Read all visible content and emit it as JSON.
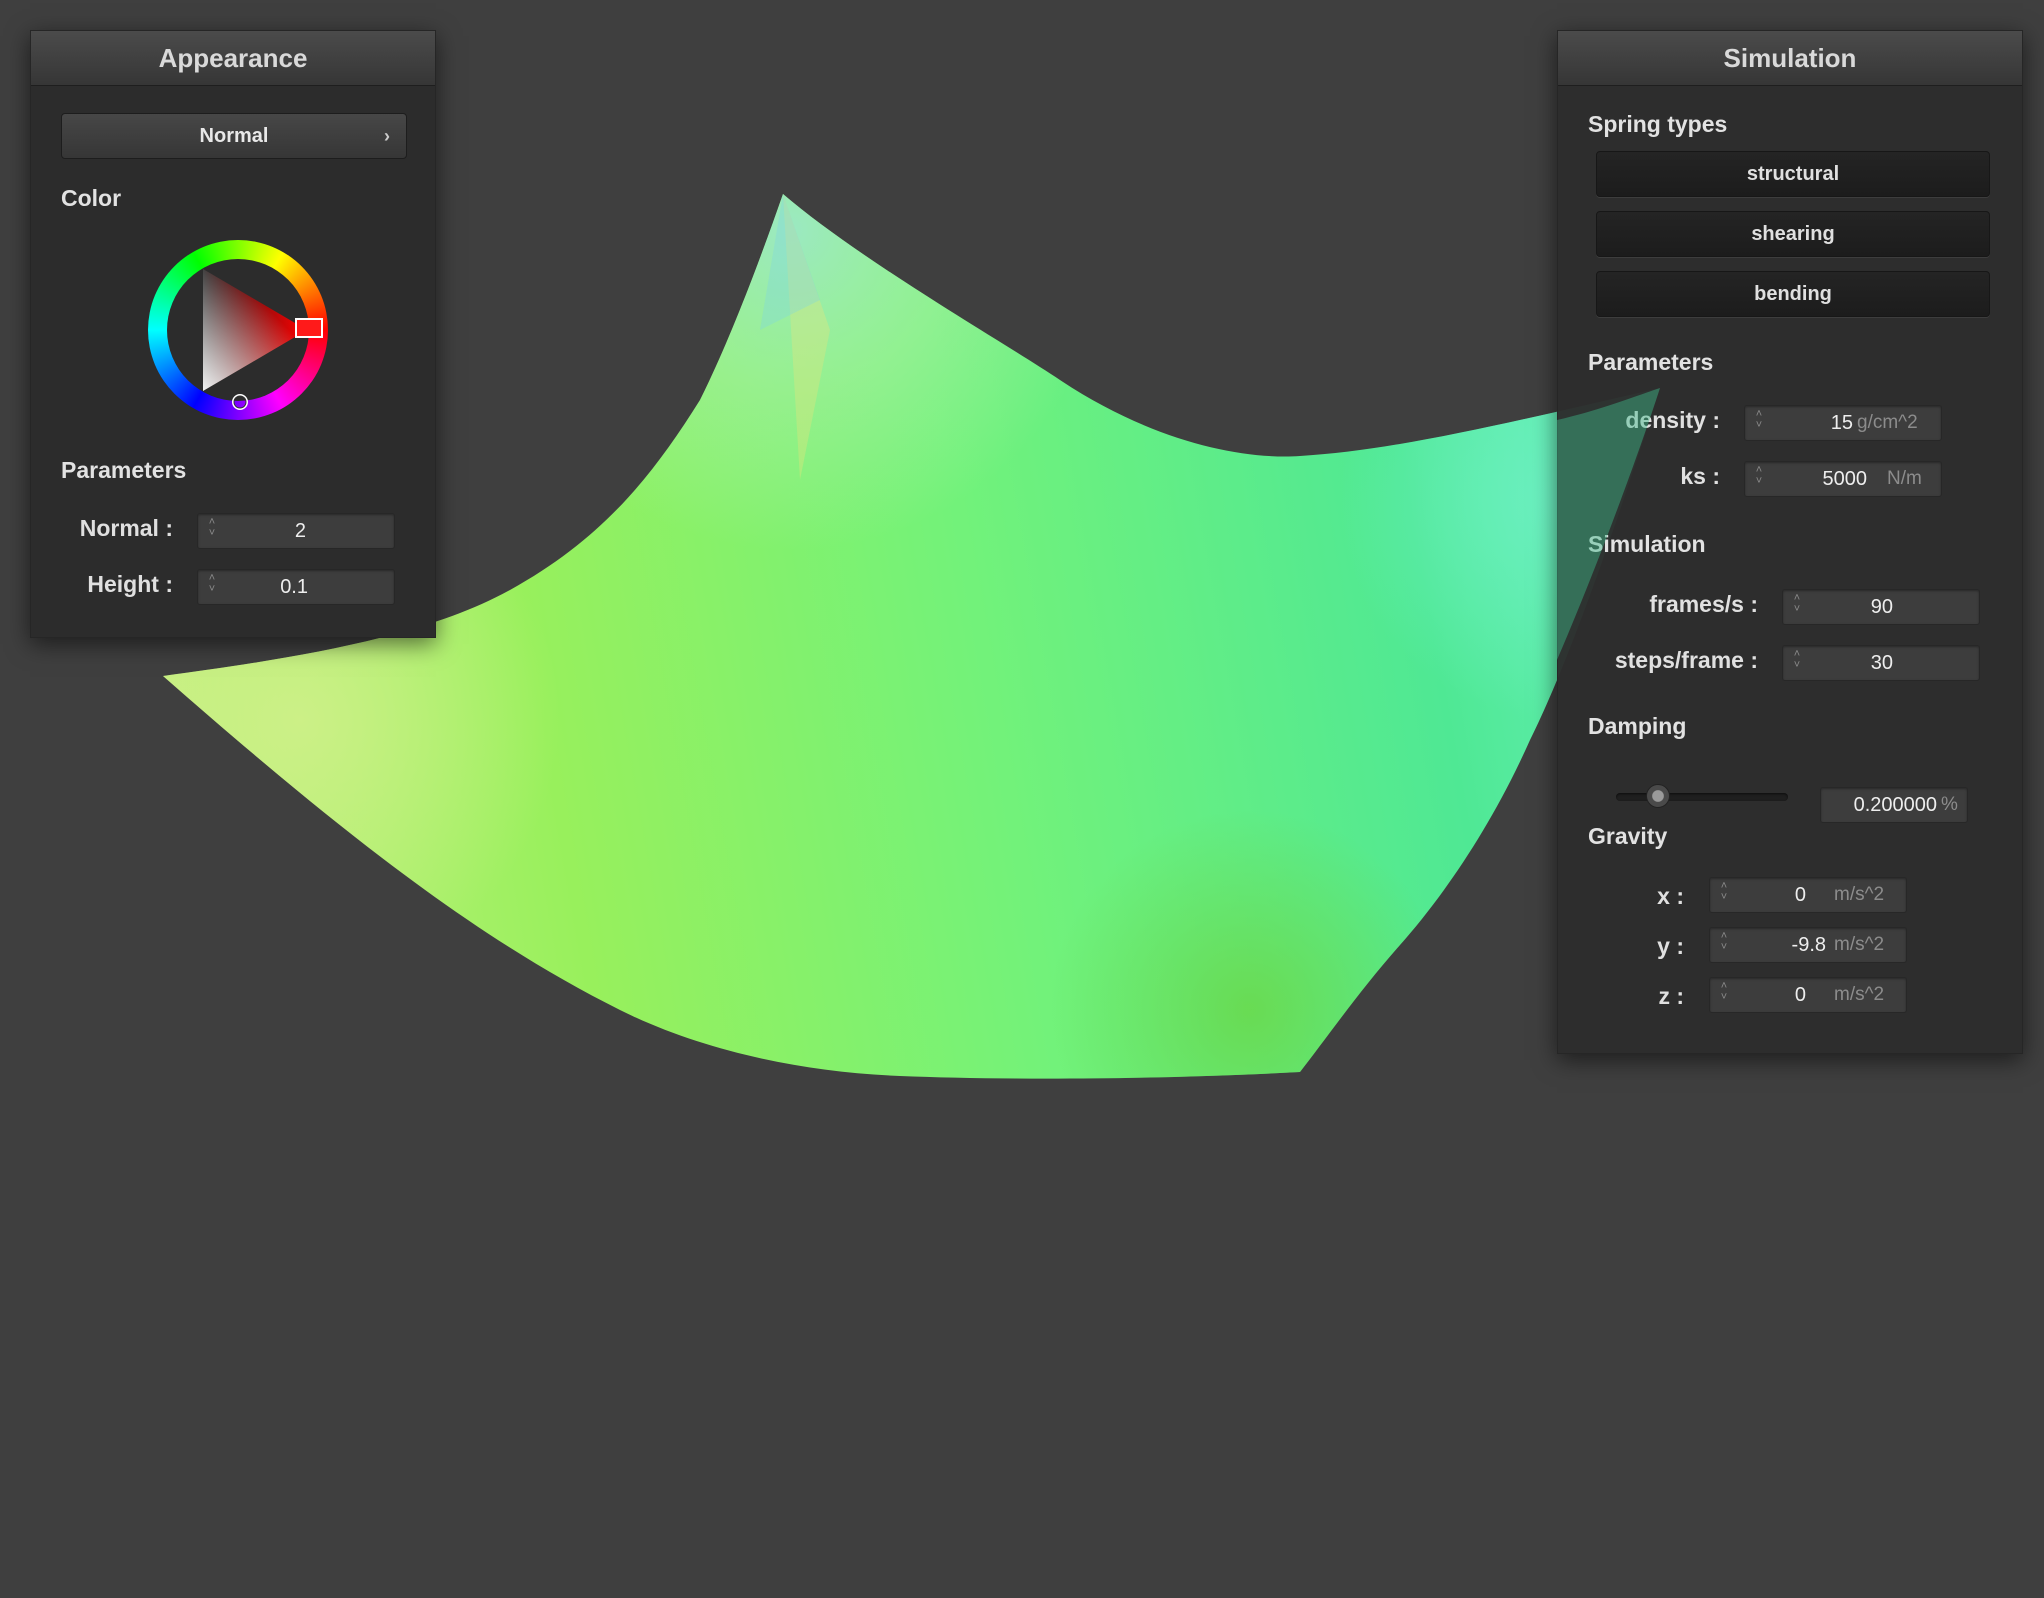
{
  "appearance": {
    "title": "Appearance",
    "mode_label": "Normal",
    "color_label": "Color",
    "parameters_label": "Parameters",
    "normal_label": "Normal :",
    "normal_value": "2",
    "height_label": "Height :",
    "height_value": "0.1"
  },
  "simulation": {
    "title": "Simulation",
    "spring_types_label": "Spring types",
    "spring_buttons": [
      "structural",
      "shearing",
      "bending"
    ],
    "parameters_label": "Parameters",
    "density_label": "density :",
    "density_value": "15",
    "density_unit": "g/cm^2",
    "ks_label": "ks :",
    "ks_value": "5000",
    "ks_unit": "N/m",
    "sim_label": "Simulation",
    "fps_label": "frames/s :",
    "fps_value": "90",
    "steps_label": "steps/frame :",
    "steps_value": "30",
    "damping_label": "Damping",
    "damping_value": "0.200000",
    "damping_unit": "%",
    "damping_fraction": 0.2,
    "gravity_label": "Gravity",
    "gx_label": "x :",
    "gx_value": "0",
    "gy_label": "y :",
    "gy_value": "-9.8",
    "gz_label": "z :",
    "gz_value": "0",
    "gravity_unit": "m/s^2"
  },
  "colors": {
    "background": "#3f3f3f",
    "panel": "#2c2c2c",
    "cloth_light": "#b8f07a",
    "cloth_mid": "#6ef070",
    "cloth_cyan": "#5ff0b0",
    "selected_color": "#ff0000"
  },
  "icons": {
    "spinner": "up-down-spinner-icon",
    "dropdown": "chevron-right-icon"
  }
}
